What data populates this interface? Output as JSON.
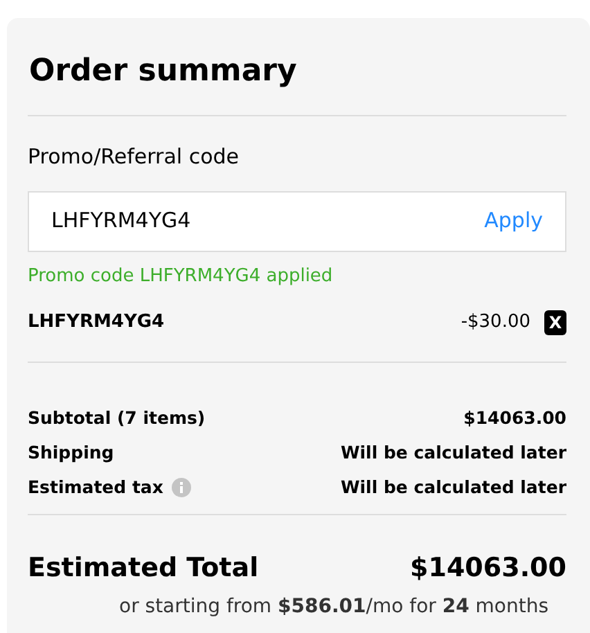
{
  "title": "Order summary",
  "promo": {
    "label": "Promo/Referral code",
    "value": "LHFYRM4YG4",
    "apply": "Apply",
    "message": "Promo code LHFYRM4YG4 applied"
  },
  "applied_codes": [
    {
      "code": "LHFYRM4YG4",
      "amount": "-$30.00",
      "remove": "X"
    }
  ],
  "lines": [
    {
      "label": "Subtotal (7 items)",
      "value": "$14063.00",
      "info": false
    },
    {
      "label": "Shipping",
      "value": "Will be calculated later",
      "info": false
    },
    {
      "label": "Estimated tax",
      "value": "Will be calculated later",
      "info": true
    }
  ],
  "total": {
    "label": "Estimated Total",
    "value": "$14063.00",
    "financing": "or starting from **$586.01**/mo for **24** months"
  }
}
